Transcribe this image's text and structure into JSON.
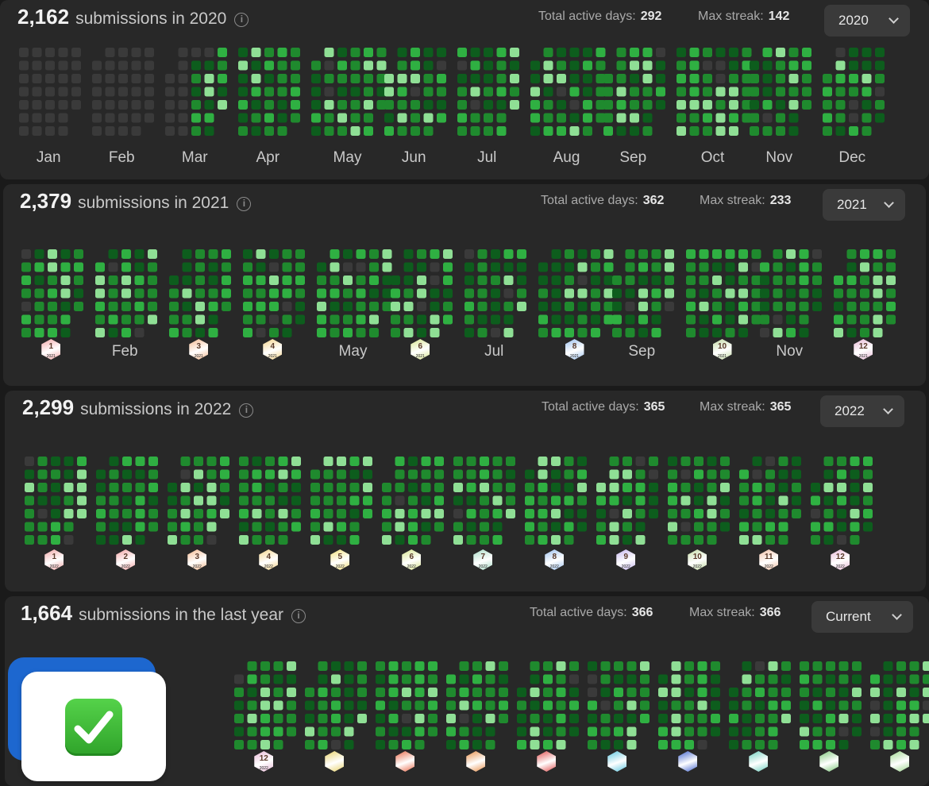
{
  "panels": [
    {
      "count": "2,162",
      "text": "submissions in 2020",
      "active_label": "Total active days:",
      "active": "292",
      "streak_label": "Max streak:",
      "streak": "142",
      "dropdown": "2020",
      "months": [
        "Jan",
        "Feb",
        "Mar",
        "Apr",
        "May",
        "Jun",
        "Jul",
        "Aug",
        "Sep",
        "Oct",
        "Nov",
        "Dec"
      ]
    },
    {
      "count": "2,379",
      "text": "submissions in 2021",
      "active_label": "Total active days:",
      "active": "362",
      "streak_label": "Max streak:",
      "streak": "233",
      "dropdown": "2021",
      "months": [
        "badge:1",
        "Feb",
        "badge:3",
        "badge:4",
        "May",
        "badge:6",
        "Jul",
        "badge:8",
        "Sep",
        "badge:10",
        "Nov",
        "badge:12"
      ],
      "badge_year": "2021"
    },
    {
      "count": "2,299",
      "text": "submissions in 2022",
      "active_label": "Total active days:",
      "active": "365",
      "streak_label": "Max streak:",
      "streak": "365",
      "dropdown": "2022",
      "months": [
        "badge:1",
        "badge:2",
        "badge:3",
        "badge:4",
        "badge:5",
        "badge:6",
        "badge:7",
        "badge:8",
        "badge:9",
        "badge:10",
        "badge:11",
        "badge:12"
      ],
      "badge_year": "2022"
    },
    {
      "count": "1,664",
      "text": "submissions in the last year",
      "active_label": "Total active days:",
      "active": "366",
      "streak_label": "Max streak:",
      "streak": "366",
      "dropdown": "Current",
      "months": [
        "",
        "badge:12",
        "badge:",
        "badge:",
        "badge:",
        "badge:",
        "badge:",
        "badge:",
        "badge:",
        "badge:",
        "badge:"
      ],
      "badge_year": "2022"
    }
  ],
  "colors": {
    "cell_empty": "#3a3a3a",
    "cell_l1": "#0d5d1d",
    "cell_l2": "#1f8a2e",
    "cell_l3": "#2fb042",
    "cell_l4": "#8fdf95",
    "badge_tints": [
      "#f1a7a7",
      "#f3a3a3",
      "#f4b98f",
      "#f5d48a",
      "#f3e07a",
      "#d8e48f",
      "#a9dcc6",
      "#9dc1ee",
      "#c6b6ee",
      "#c4dba5",
      "#f2c1a6",
      "#e8b9d6"
    ]
  },
  "icons": {
    "info": "info-icon",
    "dropdown": "chevron-down-icon",
    "overlay": "check-mark-button-emoji"
  }
}
